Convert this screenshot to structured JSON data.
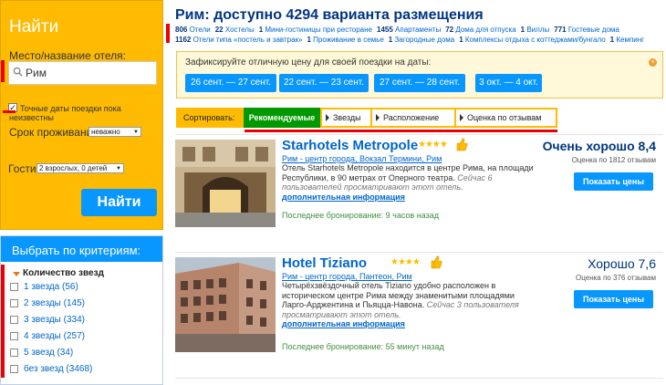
{
  "search": {
    "title": "Найти",
    "place_label": "Место/название отеля:",
    "place_value": "Рим",
    "dates_checkbox_label": "Точные даты поездки пока неизвестны",
    "stay_label": "Срок проживания",
    "stay_value": "неважно",
    "guests_label": "Гости",
    "guests_value": "2 взрослых, 0 детей",
    "button": "Найти"
  },
  "filters": {
    "title": "Выбрать по критериям:",
    "stars_heading": "Количество звезд",
    "stars": [
      {
        "label": "1 звезда (56)"
      },
      {
        "label": "2 звезды (145)"
      },
      {
        "label": "3 звезды (334)"
      },
      {
        "label": "4 звезды (257)"
      },
      {
        "label": "5 звезд (34)"
      },
      {
        "label": "без звезд (3468)"
      }
    ]
  },
  "header": {
    "title": "Рим: доступно 4294 варианта размещения",
    "categories_line1": [
      {
        "count": "806",
        "label": "Отели"
      },
      {
        "count": "22",
        "label": "Хостелы"
      },
      {
        "count": "1",
        "label": "Мини-гостиницы при ресторане"
      },
      {
        "count": "1455",
        "label": "Апартаменты"
      },
      {
        "count": "72",
        "label": "Дома для отпуска"
      },
      {
        "count": "1",
        "label": "Виллы"
      },
      {
        "count": "771",
        "label": "Гостевые дома"
      }
    ],
    "categories_line2": [
      {
        "count": "1162",
        "label": "Отели типа «постель и завтрак»"
      },
      {
        "count": "1",
        "label": "Проживание в семье"
      },
      {
        "count": "1",
        "label": "Загородные дома"
      },
      {
        "count": "1",
        "label": "Комплексы отдыха с коттеджами/бунгало"
      },
      {
        "count": "1",
        "label": "Кемпинг"
      }
    ]
  },
  "date_suggestion": {
    "prompt": "Зафиксируйте отличную цену для своей поездки на даты:",
    "close_icon": "×",
    "dates": [
      "26 сент. — 27 сент.",
      "22 сент. — 23 сент.",
      "27 сент. — 28 сент.",
      "3 окт. — 4 окт."
    ]
  },
  "sort": {
    "label": "Сортировать:",
    "active": "Рекомендуемые",
    "options": [
      "Звезды",
      "Расположение",
      "Оценка по отзывам"
    ]
  },
  "hotels": [
    {
      "name": "Starhotels Metropole",
      "stars": 4,
      "stars_text": "★★★★",
      "location": "Рим - центр города, Вокзал Термини, Рим",
      "description": "Отель Starhotels Metropole находится в центре Рима, на площади Республики, в 90 метрах от Оперного театра.",
      "viewers": "Сейчас 6 пользователей просматривают этот отель.",
      "more": "дополнительная информация",
      "booked": "Последнее бронирование: 9 часов назад",
      "score": "Очень хорошо 8,4",
      "reviews": "Оценка по 1812 отзывам",
      "cta": "Показать цены"
    },
    {
      "name": "Hotel Tiziano",
      "stars": 4,
      "stars_text": "★★★★",
      "location": "Рим - центр города, Пантеон, Рим",
      "description": "Четырёхзвёздочный отель Tiziano удобно расположен в историческом центре Рима между знаменитыми площадями Ларго-Арджентина и Пьяцца-Навона.",
      "viewers": "Сейчас 3 пользователя просматривают этот отель.",
      "more": "дополнительная информация",
      "booked": "Последнее бронирование: 55 минут назад",
      "score": "Хорошо 7,6",
      "reviews": "Оценка по 376 отзывам",
      "cta": "Показать цены"
    }
  ],
  "colors": {
    "brand_yellow": "#febb02",
    "brand_blue": "#0896ff",
    "title_navy": "#003580",
    "sort_active_green": "#009900",
    "annotation_red": "#e00000"
  },
  "icons": [
    "search-icon",
    "close-icon",
    "thumbs-up-icon",
    "caret-down-icon"
  ]
}
